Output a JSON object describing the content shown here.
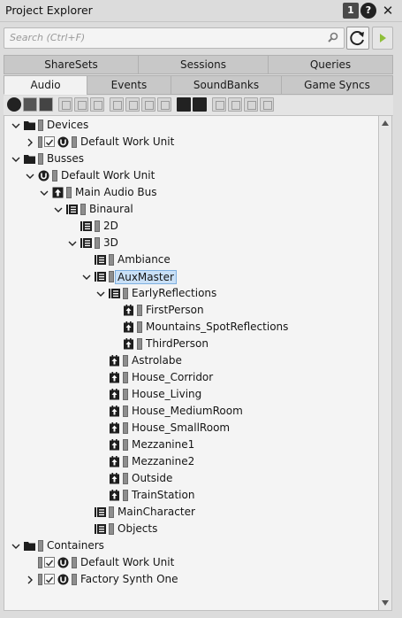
{
  "window": {
    "title": "Project Explorer",
    "badge": "1",
    "help": "?",
    "close": "✕"
  },
  "search": {
    "placeholder": "Search (Ctrl+F)"
  },
  "tabs_top": [
    "ShareSets",
    "Sessions",
    "Queries"
  ],
  "tabs_bottom": [
    "Audio",
    "Events",
    "SoundBanks",
    "Game Syncs"
  ],
  "active_tab": "Audio",
  "tree": [
    {
      "level": 0,
      "label": "Devices",
      "icon": "folder-icon",
      "chevron": "down"
    },
    {
      "level": 1,
      "label": "Default Work Unit",
      "icon": "workunit-icon",
      "chevron": "right",
      "wu": true
    },
    {
      "level": 0,
      "label": "Busses",
      "icon": "folder-icon",
      "chevron": "down"
    },
    {
      "level": 1,
      "label": "Default Work Unit",
      "icon": "workunit-icon",
      "chevron": "down"
    },
    {
      "level": 2,
      "label": "Main Audio Bus",
      "icon": "audio-bus-icon",
      "chevron": "down"
    },
    {
      "level": 3,
      "label": "Binaural",
      "icon": "bus-icon",
      "chevron": "down"
    },
    {
      "level": 4,
      "label": "2D",
      "icon": "bus-icon",
      "chevron": "none"
    },
    {
      "level": 4,
      "label": "3D",
      "icon": "bus-icon",
      "chevron": "down"
    },
    {
      "level": 5,
      "label": "Ambiance",
      "icon": "bus-icon",
      "chevron": "none"
    },
    {
      "level": 5,
      "label": "AuxMaster",
      "icon": "bus-icon",
      "chevron": "down",
      "selected": true
    },
    {
      "level": 6,
      "label": "EarlyReflections",
      "icon": "bus-icon",
      "chevron": "down"
    },
    {
      "level": 7,
      "label": "FirstPerson",
      "icon": "aux-bus-icon",
      "chevron": "none"
    },
    {
      "level": 7,
      "label": "Mountains_SpotReflections",
      "icon": "aux-bus-icon",
      "chevron": "none"
    },
    {
      "level": 7,
      "label": "ThirdPerson",
      "icon": "aux-bus-icon",
      "chevron": "none"
    },
    {
      "level": 6,
      "label": "Astrolabe",
      "icon": "aux-bus-icon",
      "chevron": "none"
    },
    {
      "level": 6,
      "label": "House_Corridor",
      "icon": "aux-bus-icon",
      "chevron": "none"
    },
    {
      "level": 6,
      "label": "House_Living",
      "icon": "aux-bus-icon",
      "chevron": "none"
    },
    {
      "level": 6,
      "label": "House_MediumRoom",
      "icon": "aux-bus-icon",
      "chevron": "none"
    },
    {
      "level": 6,
      "label": "House_SmallRoom",
      "icon": "aux-bus-icon",
      "chevron": "none"
    },
    {
      "level": 6,
      "label": "Mezzanine1",
      "icon": "aux-bus-icon",
      "chevron": "none"
    },
    {
      "level": 6,
      "label": "Mezzanine2",
      "icon": "aux-bus-icon",
      "chevron": "none"
    },
    {
      "level": 6,
      "label": "Outside",
      "icon": "aux-bus-icon",
      "chevron": "none"
    },
    {
      "level": 6,
      "label": "TrainStation",
      "icon": "aux-bus-icon",
      "chevron": "none"
    },
    {
      "level": 5,
      "label": "MainCharacter",
      "icon": "bus-icon",
      "chevron": "none"
    },
    {
      "level": 5,
      "label": "Objects",
      "icon": "bus-icon",
      "chevron": "none"
    },
    {
      "level": 0,
      "label": "Containers",
      "icon": "folder-icon",
      "chevron": "down"
    },
    {
      "level": 1,
      "label": "Default Work Unit",
      "icon": "workunit-icon",
      "chevron": "none",
      "wu": true
    },
    {
      "level": 1,
      "label": "Factory Synth One",
      "icon": "workunit-icon",
      "chevron": "right",
      "wu": true
    }
  ]
}
